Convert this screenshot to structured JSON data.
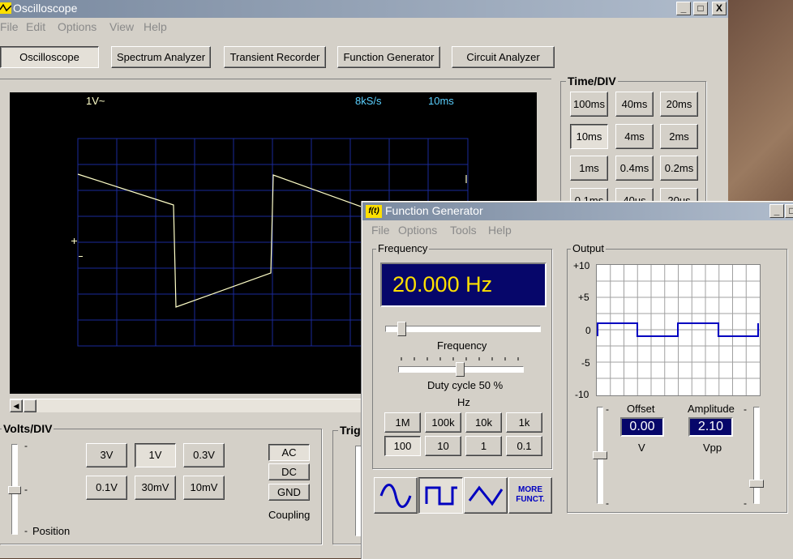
{
  "scope": {
    "title": "Oscilloscope",
    "menu": [
      "File",
      "Edit",
      "Options",
      "View",
      "Help"
    ],
    "tabs": [
      "Oscilloscope",
      "Spectrum Analyzer",
      "Transient Recorder",
      "Function Generator",
      "Circuit Analyzer"
    ],
    "screen": {
      "volts": "1V~",
      "rate": "8kS/s",
      "time": "10ms"
    },
    "timediv": {
      "label": "Time/DIV",
      "buttons": [
        "100ms",
        "40ms",
        "20ms",
        "10ms",
        "4ms",
        "2ms",
        "1ms",
        "0.4ms",
        "0.2ms",
        "0.1ms",
        "40us",
        "20us"
      ],
      "selected": "10ms"
    },
    "voltsdiv": {
      "label": "Volts/DIV",
      "buttons": [
        "3V",
        "1V",
        "0.3V",
        "0.1V",
        "30mV",
        "10mV"
      ],
      "selected": "1V",
      "position_label": "Position"
    },
    "coupling": {
      "buttons": [
        "AC",
        "DC",
        "GND"
      ],
      "label": "Coupling"
    },
    "trigger_label": "Trig"
  },
  "fg": {
    "title": "Function Generator",
    "icon_text": "f(t)",
    "menu": [
      "File",
      "Options",
      "Tools",
      "Help"
    ],
    "frequency_group": "Frequency",
    "display": "20.000 Hz",
    "frequency_label": "Frequency",
    "duty_label": "Duty cycle  50 %",
    "hz_label": "Hz",
    "range_buttons": [
      "1M",
      "100k",
      "10k",
      "1k",
      "100",
      "10",
      "1",
      "0.1"
    ],
    "range_selected": "100",
    "more_line1": "MORE",
    "more_line2": "FUNCT.",
    "output_group": "Output",
    "yticks": [
      "+10",
      "+5",
      "0",
      "-5",
      "-10"
    ],
    "offset_label": "Offset",
    "offset_value": "0.00",
    "offset_unit": "V",
    "amplitude_label": "Amplitude",
    "amplitude_value": "2.10",
    "amplitude_unit": "Vpp",
    "waveforms": [
      "sine-wave-icon",
      "square-wave-icon",
      "triangle-wave-icon"
    ],
    "selected_waveform": "square"
  },
  "colors": {
    "trace": "#ffffc8",
    "grid": "#1a2a9a",
    "lcd": "#06066a",
    "lcd_text": "#ffe000",
    "output_wave": "#0000c0"
  }
}
